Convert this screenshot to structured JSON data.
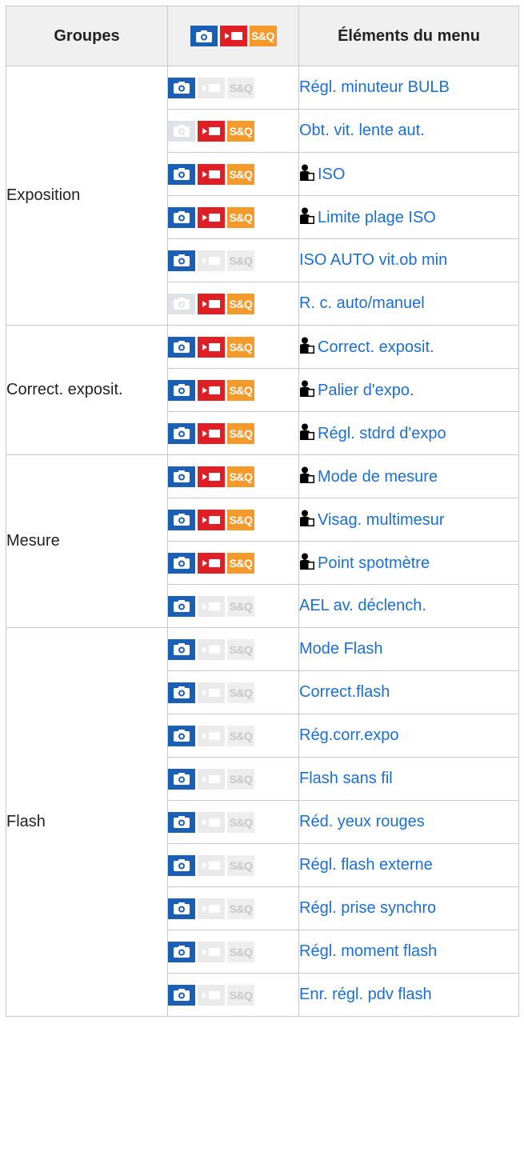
{
  "header": {
    "groups": "Groupes",
    "modes": "",
    "items": "Éléments du menu",
    "sq_label": "S&Q"
  },
  "colors": {
    "photo_on": "#1a5fb4",
    "movie_on": "#e01e25",
    "sq_on": "#f39a2b",
    "link": "#1a6fd1",
    "inactive": "#e6e6e6"
  },
  "groups": [
    {
      "name": "Exposition",
      "start": 0,
      "count": 6
    },
    {
      "name": "Correct. exposit.",
      "start": 6,
      "count": 3
    },
    {
      "name": "Mesure",
      "start": 9,
      "count": 4
    },
    {
      "name": "Flash",
      "start": 13,
      "count": 9
    }
  ],
  "rows": [
    {
      "label": "Régl. minuteur BULB",
      "photo": true,
      "movie": false,
      "sq": false,
      "icon": false
    },
    {
      "label": "Obt. vit. lente aut.",
      "photo": false,
      "movie": true,
      "sq": true,
      "icon": false
    },
    {
      "label": "ISO",
      "photo": true,
      "movie": true,
      "sq": true,
      "icon": true
    },
    {
      "label": "Limite plage ISO",
      "photo": true,
      "movie": true,
      "sq": true,
      "icon": true
    },
    {
      "label": "ISO AUTO vit.ob min",
      "photo": true,
      "movie": false,
      "sq": false,
      "icon": false
    },
    {
      "label": "R. c. auto/manuel",
      "photo": false,
      "movie": true,
      "sq": true,
      "icon": false
    },
    {
      "label": "Correct. exposit.",
      "photo": true,
      "movie": true,
      "sq": true,
      "icon": true
    },
    {
      "label": "Palier d'expo.",
      "photo": true,
      "movie": true,
      "sq": true,
      "icon": true
    },
    {
      "label": "Régl. stdrd d'expo",
      "photo": true,
      "movie": true,
      "sq": true,
      "icon": true
    },
    {
      "label": "Mode de mesure",
      "photo": true,
      "movie": true,
      "sq": true,
      "icon": true
    },
    {
      "label": "Visag. multimesur",
      "photo": true,
      "movie": true,
      "sq": true,
      "icon": true
    },
    {
      "label": "Point spotmètre",
      "photo": true,
      "movie": true,
      "sq": true,
      "icon": true
    },
    {
      "label": "AEL av. déclench.",
      "photo": true,
      "movie": false,
      "sq": false,
      "icon": false
    },
    {
      "label": "Mode Flash",
      "photo": true,
      "movie": false,
      "sq": false,
      "icon": false
    },
    {
      "label": "Correct.flash",
      "photo": true,
      "movie": false,
      "sq": false,
      "icon": false
    },
    {
      "label": "Rég.corr.expo",
      "photo": true,
      "movie": false,
      "sq": false,
      "icon": false
    },
    {
      "label": "Flash sans fil",
      "photo": true,
      "movie": false,
      "sq": false,
      "icon": false
    },
    {
      "label": "Réd. yeux rouges",
      "photo": true,
      "movie": false,
      "sq": false,
      "icon": false
    },
    {
      "label": "Régl. flash externe",
      "photo": true,
      "movie": false,
      "sq": false,
      "icon": false
    },
    {
      "label": "Régl. prise synchro",
      "photo": true,
      "movie": false,
      "sq": false,
      "icon": false
    },
    {
      "label": "Régl. moment flash",
      "photo": true,
      "movie": false,
      "sq": false,
      "icon": false
    },
    {
      "label": "Enr. régl. pdv flash",
      "photo": true,
      "movie": false,
      "sq": false,
      "icon": false
    }
  ]
}
